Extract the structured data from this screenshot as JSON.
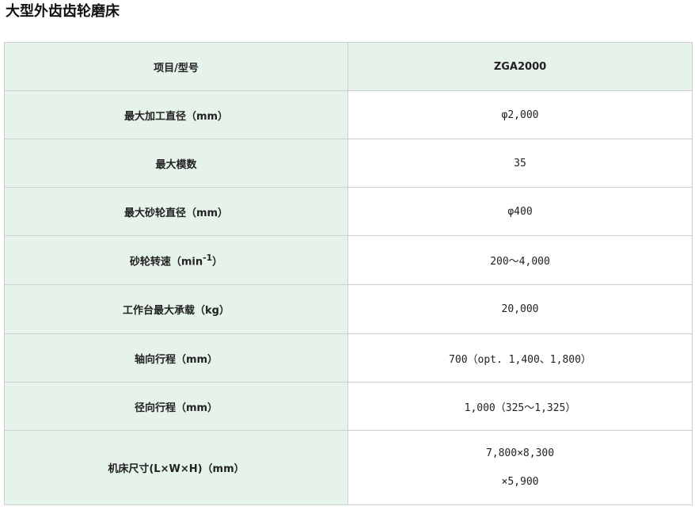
{
  "page": {
    "title": "大型外齿齿轮磨床"
  },
  "table": {
    "header": {
      "label": "项目/型号",
      "value": "ZGA2000"
    },
    "rows": [
      {
        "label": "最大加工直径（mm）",
        "value": "φ2,000"
      },
      {
        "label": "最大模数",
        "value": "35"
      },
      {
        "label": "最大砂轮直径（mm）",
        "value": "φ400"
      },
      {
        "label_prefix": "砂轮转速（min",
        "label_sup": "-1",
        "label_suffix": "）",
        "value": "200～4,000"
      },
      {
        "label": "工作台最大承载（kg）",
        "value": "20,000"
      },
      {
        "label": "轴向行程（mm）",
        "value": "700（opt. 1,400、1,800）"
      },
      {
        "label": "径向行程（mm）",
        "value": "1,000（325～1,325）"
      },
      {
        "label": "机床尺寸(L×W×H)（mm）",
        "value_line1": "7,800×8,300",
        "value_line2": "×5,900"
      }
    ]
  }
}
